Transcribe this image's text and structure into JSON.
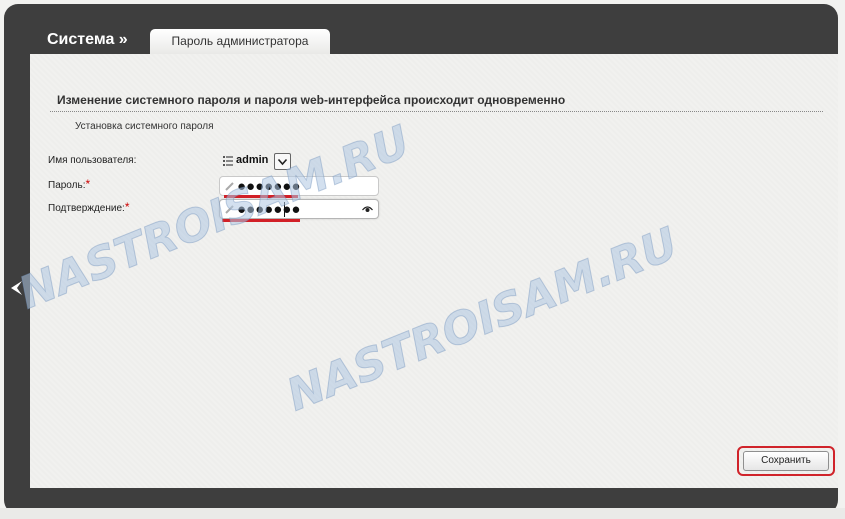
{
  "header": {
    "section_title": "Система »",
    "active_tab": "Пароль администратора"
  },
  "form": {
    "heading": "Изменение системного пароля и пароля web-интерфейса происходит одновременно",
    "subheading": "Установка системного пароля",
    "username_label": "Имя пользователя:",
    "username_value": "admin",
    "password_label": "Пароль:",
    "password_value": "●●●●●●●",
    "confirm_label": "Подтверждение:",
    "confirm_value": "●●●●●●●",
    "required_mark": "*"
  },
  "actions": {
    "save_label": "Сохранить"
  },
  "watermark": {
    "text": "NASTROISAM.RU"
  },
  "colors": {
    "frame": "#3e3e3e",
    "panel": "#f1f1ef",
    "highlight": "#d22027",
    "required": "#cc0000",
    "watermark": "#afc6e1"
  }
}
